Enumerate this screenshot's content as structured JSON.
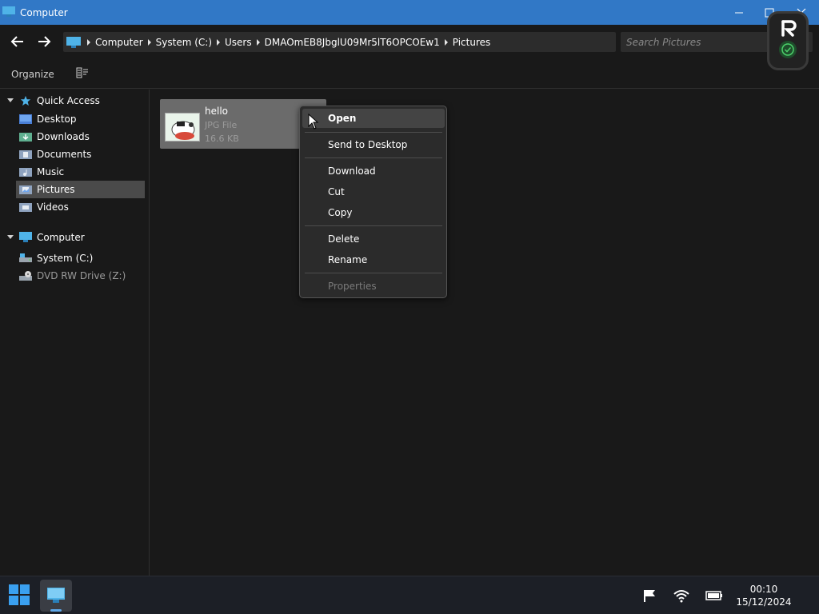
{
  "window": {
    "title": "Computer"
  },
  "address": {
    "breadcrumbs": [
      "Computer",
      "System (C:)",
      "Users",
      "DMAOmEB8JbglU09Mr5lT6OPCOEw1",
      "Pictures"
    ],
    "search_placeholder": "Search Pictures"
  },
  "toolbar": {
    "organize_label": "Organize",
    "view_icon": "details-view-icon"
  },
  "sidebar": {
    "quick_access": {
      "label": "Quick Access",
      "icon": "star-icon",
      "items": [
        {
          "label": "Desktop",
          "icon": "desktop-folder-icon"
        },
        {
          "label": "Downloads",
          "icon": "downloads-folder-icon"
        },
        {
          "label": "Documents",
          "icon": "documents-folder-icon"
        },
        {
          "label": "Music",
          "icon": "music-folder-icon"
        },
        {
          "label": "Pictures",
          "icon": "pictures-folder-icon",
          "selected": true
        },
        {
          "label": "Videos",
          "icon": "videos-folder-icon"
        }
      ]
    },
    "computer": {
      "label": "Computer",
      "icon": "computer-icon",
      "items": [
        {
          "label": "System (C:)",
          "icon": "drive-icon"
        },
        {
          "label": "DVD RW Drive (Z:)",
          "icon": "dvd-drive-icon"
        }
      ]
    }
  },
  "files": [
    {
      "name": "hello",
      "type": "JPG File",
      "size": "16.6 KB"
    }
  ],
  "context_menu": {
    "groups": [
      [
        {
          "label": "Open",
          "hover": true
        }
      ],
      [
        {
          "label": "Send to Desktop"
        }
      ],
      [
        {
          "label": "Download"
        },
        {
          "label": "Cut"
        },
        {
          "label": "Copy"
        }
      ],
      [
        {
          "label": "Delete"
        },
        {
          "label": "Rename"
        }
      ],
      [
        {
          "label": "Properties",
          "disabled": true
        }
      ]
    ]
  },
  "taskbar": {
    "time": "00:10",
    "date": "15/12/2024",
    "tray_icons": [
      "flag-icon",
      "wifi-icon",
      "battery-icon"
    ]
  },
  "colors": {
    "titlebar": "#3178c6",
    "background": "#191919",
    "selection": "#4a4a4a",
    "menu_bg": "#2b2b2b",
    "accent_icon": "#4fb3e8"
  }
}
